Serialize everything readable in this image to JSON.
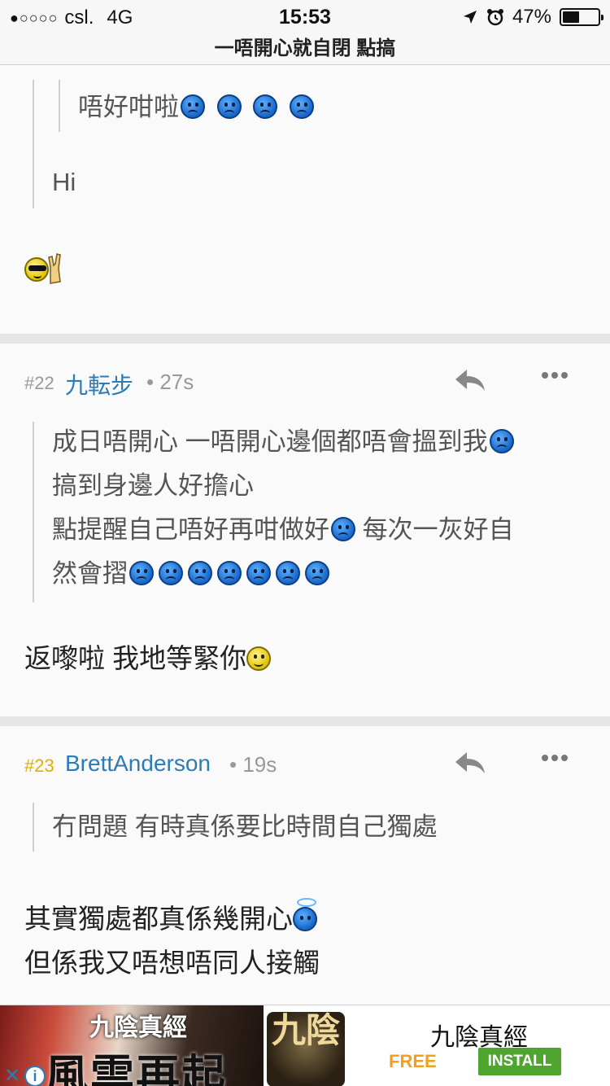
{
  "status_bar": {
    "carrier": "csl.",
    "signal_dots": "●○○○○",
    "network": "4G",
    "time": "15:53",
    "battery_percent": "47%",
    "battery_level": 0.47
  },
  "thread": {
    "title": "一唔開心就自閉 點搞"
  },
  "posts": [
    {
      "nested_quote": "唔好咁啦",
      "nested_quote_emojis": [
        "sad",
        "sad",
        "sad",
        "sad"
      ],
      "quote": "Hi",
      "body_emoji": "cool-rock"
    },
    {
      "floor": "#22",
      "author": "九転步",
      "time": "• 27s",
      "quote_lines": [
        "成日唔開心 一唔開心邊個都唔會搵到我",
        "搞到身邊人好擔心",
        "點提醒自己唔好再咁做好",
        "每次一灰好自",
        "然會摺"
      ],
      "body": "返嚟啦 我地等緊你"
    },
    {
      "floor": "#23",
      "author": "BrettAnderson",
      "time": "• 19s",
      "quote": "冇問題 有時真係要比時間自己獨處",
      "body_lines": [
        "其實獨處都真係幾開心",
        "但係我又唔想唔同人接觸"
      ]
    }
  ],
  "ad": {
    "banner_title": "風雲再起",
    "banner_sub": "九陰真經",
    "logo_text": "九陰",
    "title": "九陰真經",
    "price": "FREE",
    "install_label": "INSTALL",
    "close_glyph": "✕",
    "info_glyph": "i"
  },
  "colors": {
    "author": "#2b7bb8",
    "floor_highlight": "#e0b000",
    "install": "#4fa52e",
    "free": "#f0a020"
  }
}
